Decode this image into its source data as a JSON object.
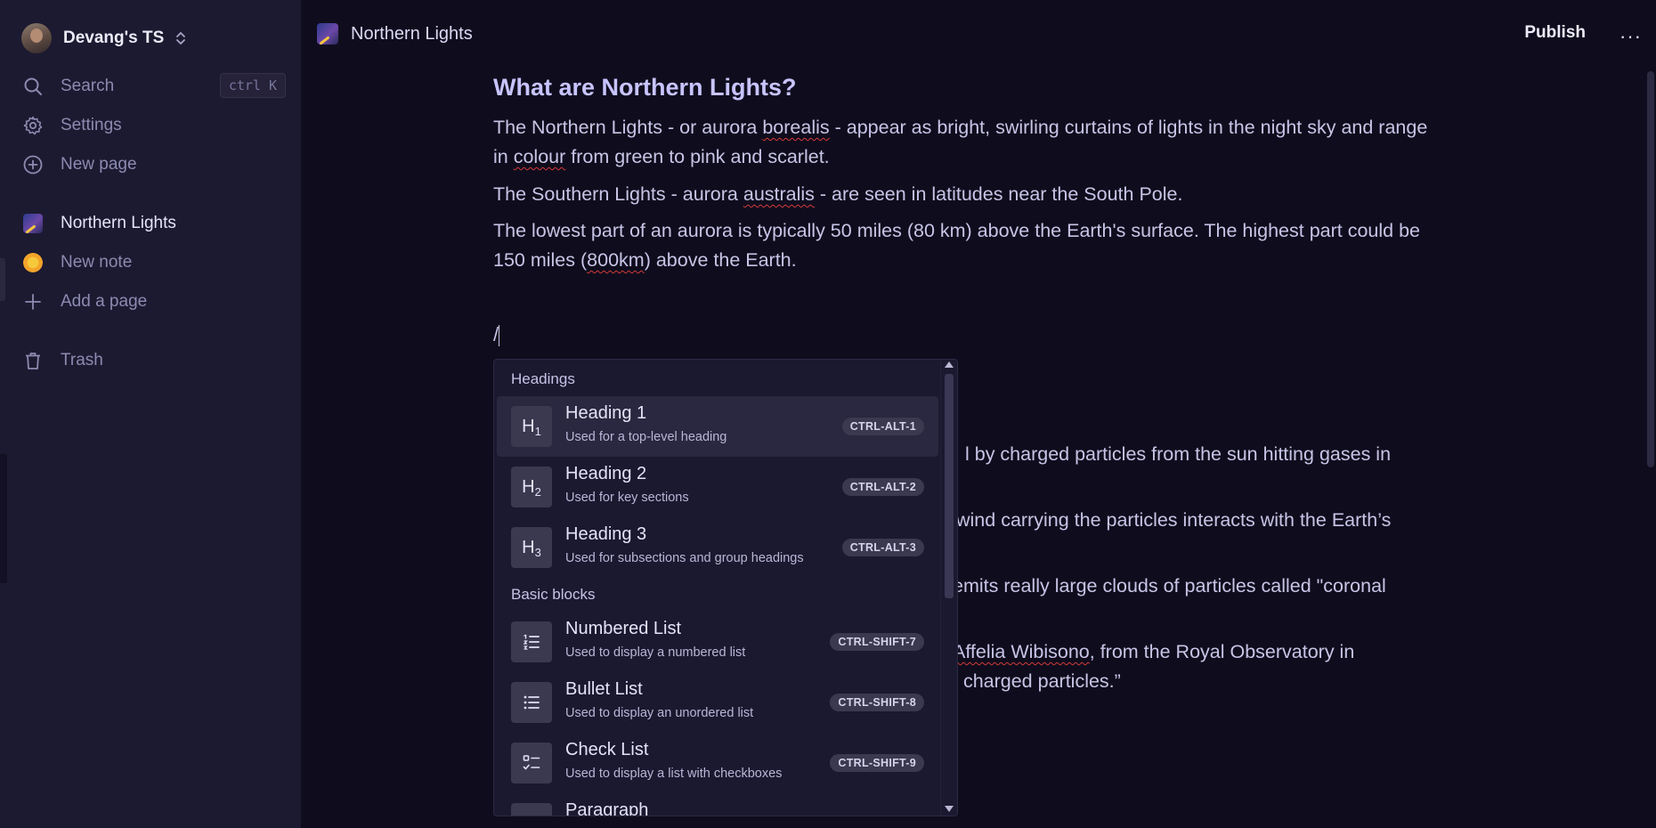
{
  "workspace": {
    "name": "Devang's TS"
  },
  "sidebar": {
    "search": {
      "label": "Search",
      "shortcut": "ctrl K"
    },
    "settings": {
      "label": "Settings"
    },
    "new_page": {
      "label": "New page"
    },
    "pages": [
      {
        "label": "Northern Lights",
        "icon": "aurora-emoji-icon"
      },
      {
        "label": "New note",
        "icon": "sunflower-emoji-icon"
      }
    ],
    "add_page": {
      "label": "Add a page"
    },
    "trash": {
      "label": "Trash"
    }
  },
  "topbar": {
    "title": "Northern Lights",
    "publish_label": "Publish",
    "more_label": "···"
  },
  "document": {
    "heading": "What are Northern Lights?",
    "p1": {
      "a": "The Northern Lights - or aurora ",
      "b": "borealis",
      "c": " - appear as bright, swirling curtains of lights in the night sky and range in ",
      "d": "colour",
      "e": " from green to pink and scarlet."
    },
    "p2": {
      "a": "The Southern Lights - aurora ",
      "b": "australis",
      "c": " - are seen in latitudes near the South Pole."
    },
    "p3": {
      "a": "The lowest part of an aurora is typically 50 miles (80 km) above the Earth's surface. The highest part could be 150 miles (",
      "b": "800km",
      "c": ") above the Earth."
    },
    "slash": "/",
    "behind_menu": {
      "line1": "l by charged particles from the sun hitting gases in",
      "line2": "wind carrying the particles interacts with the Earth’s",
      "line3": "emits really large clouds of particles called \"coronal",
      "line4a": "Affelia Wibisono",
      "line4b": ", from the Royal Observatory in",
      "line5": "f charged particles.”"
    }
  },
  "slash_menu": {
    "sections": {
      "headings": "Headings",
      "basic": "Basic blocks"
    },
    "items": [
      {
        "icon_main": "H",
        "icon_sub": "1",
        "title": "Heading 1",
        "desc": "Used for a top-level heading",
        "shortcut": "CTRL-ALT-1"
      },
      {
        "icon_main": "H",
        "icon_sub": "2",
        "title": "Heading 2",
        "desc": "Used for key sections",
        "shortcut": "CTRL-ALT-2"
      },
      {
        "icon_main": "H",
        "icon_sub": "3",
        "title": "Heading 3",
        "desc": "Used for subsections and group headings",
        "shortcut": "CTRL-ALT-3"
      },
      {
        "title": "Numbered List",
        "desc": "Used to display a numbered list",
        "shortcut": "CTRL-SHIFT-7"
      },
      {
        "title": "Bullet List",
        "desc": "Used to display an unordered list",
        "shortcut": "CTRL-SHIFT-8"
      },
      {
        "title": "Check List",
        "desc": "Used to display a list with checkboxes",
        "shortcut": "CTRL-SHIFT-9"
      },
      {
        "title": "Paragraph"
      }
    ]
  }
}
